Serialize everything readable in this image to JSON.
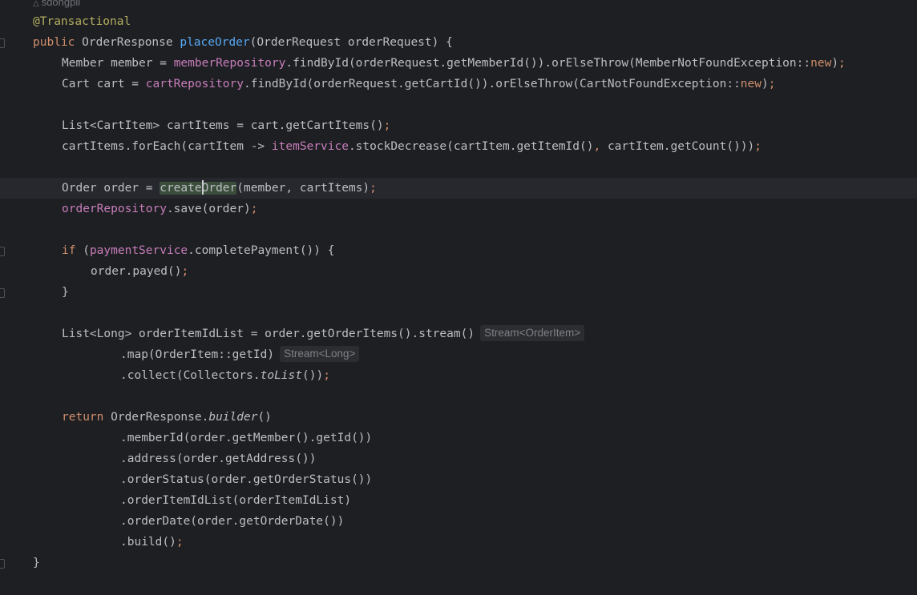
{
  "editor": {
    "author_hint": "sdongpil",
    "annotation": "@Transactional",
    "kw_public": "public",
    "kw_new": "new",
    "kw_if": "if",
    "kw_return": "return",
    "semicolon": ";",
    "comma": ",",
    "method_name": "placeOrder",
    "line1_pre": "OrderResponse ",
    "line1_post": "(OrderRequest orderRequest) {",
    "line2_pre": "Member member = ",
    "line2_field": "memberRepository",
    "line2_post": ".findById(orderRequest.getMemberId()).orElseThrow(MemberNotFoundException::",
    "line3_pre": "Cart cart = ",
    "line3_field": "cartRepository",
    "line3_post": ".findById(orderRequest.getCartId()).orElseThrow(CartNotFoundException::",
    "line5_pre": "List<CartItem> cartItems = cart.getCartItems()",
    "line6_pre": "cartItems.forEach(cartItem -> ",
    "line6_field": "itemService",
    "line6_mid": ".stockDecrease(cartItem.getItemId()",
    "line6_post": " cartItem.getCount()))",
    "line8_pre": "Order order = ",
    "line8_hl_a": "create",
    "line8_hl_b": "Order",
    "line8_post": "(member, cartItems)",
    "line9_field": "orderRepository",
    "line9_post": ".save(order)",
    "line11_pre": " (",
    "line11_field": "paymentService",
    "line11_post": ".completePayment()) {",
    "line12": "order.payed()",
    "close_brace": "}",
    "line15_code": "List<Long> orderItemIdList = order.getOrderItems().stream()",
    "line15_hint": "Stream<OrderItem>",
    "line16_code": ".map(OrderItem::getId)",
    "line16_hint": "Stream<Long>",
    "line17_pre": ".collect(Collectors.",
    "line17_static": "toList",
    "line17_post": "())",
    "line19_pre": " OrderResponse.",
    "line19_static": "builder",
    "line19_post": "()",
    "line20": ".memberId(order.getMember().getId())",
    "line21": ".address(order.getAddress())",
    "line22": ".orderStatus(order.getOrderStatus())",
    "line23": ".orderItemIdList(orderItemIdList)",
    "line24": ".orderDate(order.getOrderDate())",
    "line25": ".build()"
  },
  "colors": {
    "background": "#1e1f22",
    "current_line": "#26282e",
    "default_text": "#bcbec4",
    "keyword": "#cf8e6d",
    "annotation": "#b3ae60",
    "function_declaration": "#56a8f5",
    "field": "#c77dbb",
    "inlay_hint_text": "#7d8087",
    "identifier_highlight": "#3b4d3b"
  }
}
